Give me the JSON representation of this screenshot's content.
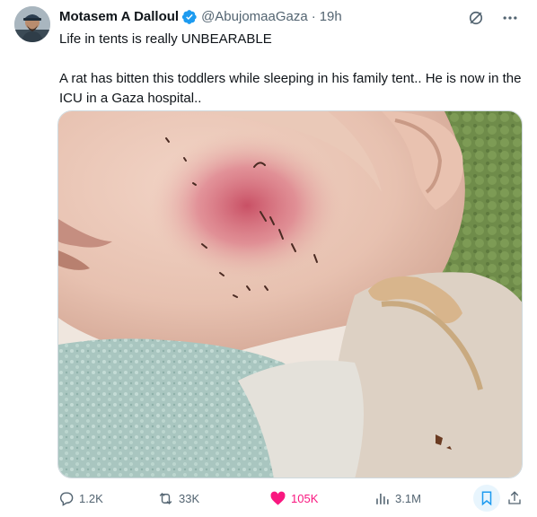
{
  "author": {
    "name": "Motasem A Dalloul",
    "handle": "@AbujomaaGaza",
    "separator": "·",
    "time": "19h",
    "verified": true
  },
  "tweet": {
    "line1": "Life in tents is really UNBEARABLE",
    "line2": "A rat has bitten this toddlers while sleeping in his family tent.. He is now in the ICU in a Gaza hospital.."
  },
  "stats": {
    "replies": "1.2K",
    "reposts": "33K",
    "likes": "105K",
    "views": "3.1M"
  },
  "colors": {
    "like_active": "#f91880",
    "verified_blue": "#1d9bf0",
    "bookmark_active": "#1d9bf0",
    "secondary_text": "#536471"
  },
  "icons": {
    "top": [
      "grok-icon",
      "more-icon"
    ],
    "actions": [
      "reply-icon",
      "repost-icon",
      "like-icon",
      "views-icon",
      "bookmark-icon",
      "share-icon"
    ]
  }
}
